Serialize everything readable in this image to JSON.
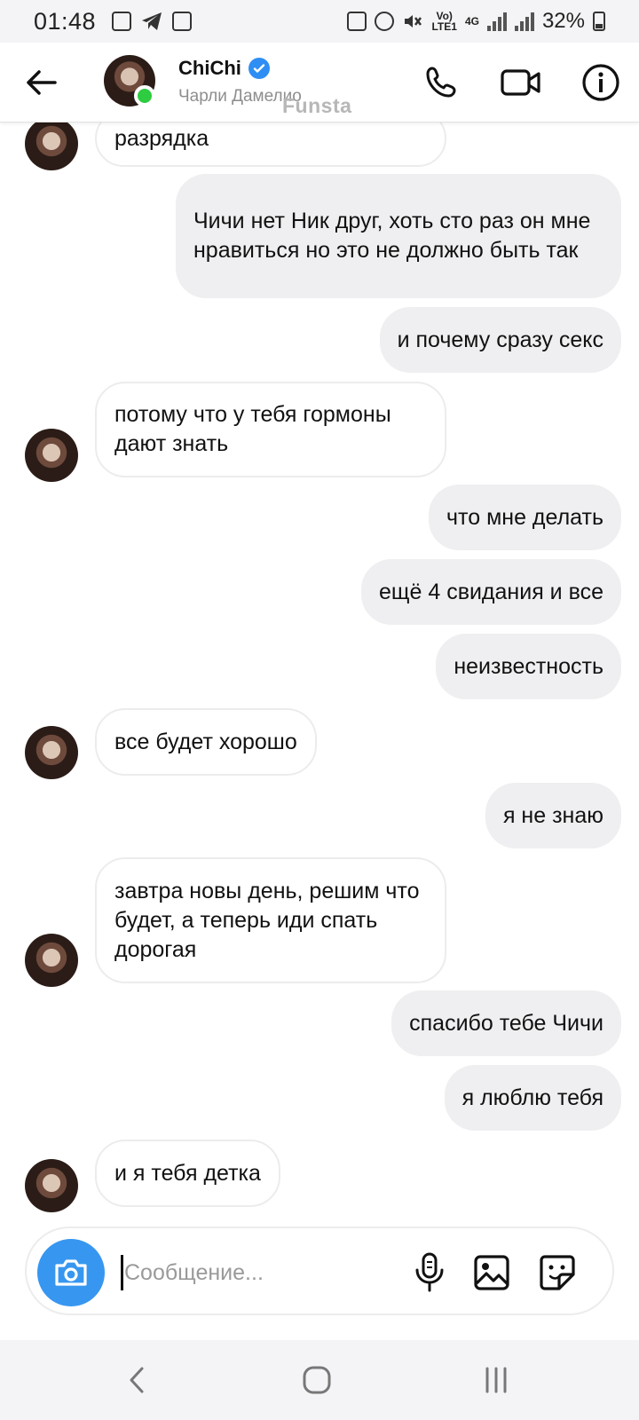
{
  "status_bar": {
    "time": "01:48",
    "network": "4G",
    "volte": "LTE1",
    "battery": "32%"
  },
  "header": {
    "contact_name": "ChiChi",
    "contact_subtitle": "Чарли Дамелио",
    "watermark": "Funsta",
    "icons": [
      "back-arrow-icon",
      "verified-badge-icon",
      "phone-icon",
      "video-camera-icon",
      "info-icon"
    ]
  },
  "messages": [
    {
      "side": "in",
      "text": "разрядка"
    },
    {
      "side": "out",
      "text": "Чичи нет Ник друг, хоть сто раз он мне нравиться но это не должно быть так"
    },
    {
      "side": "out",
      "text": "и почему сразу секс"
    },
    {
      "side": "in",
      "text": "потому что у тебя гормоны дают знать"
    },
    {
      "side": "out",
      "text": "что мне делать"
    },
    {
      "side": "out",
      "text": "ещё 4 свидания и все"
    },
    {
      "side": "out",
      "text": "неизвестность"
    },
    {
      "side": "in",
      "text": "все будет хорошо"
    },
    {
      "side": "out",
      "text": "я не знаю"
    },
    {
      "side": "in",
      "text": "завтра новы день, решим что будет, а теперь иди спать дорогая"
    },
    {
      "side": "out",
      "text": "спасибо тебе Чичи"
    },
    {
      "side": "out",
      "text": "я люблю тебя"
    },
    {
      "side": "in",
      "text": "и я тебя детка"
    }
  ],
  "composer": {
    "placeholder": "Сообщение...",
    "value": ""
  },
  "colors": {
    "accent": "#3797f0",
    "online": "#2ecc40",
    "outgoing_bubble": "#efeff1"
  }
}
